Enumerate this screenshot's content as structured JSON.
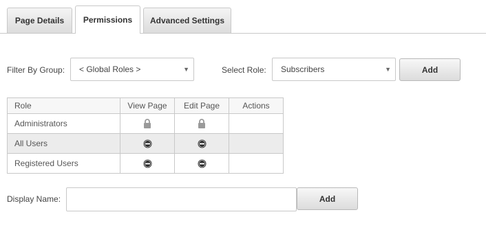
{
  "tabs": [
    {
      "label": "Page Details"
    },
    {
      "label": "Permissions"
    },
    {
      "label": "Advanced Settings"
    }
  ],
  "filter": {
    "group_label": "Filter By Group:",
    "group_value": "< Global Roles >",
    "role_label": "Select Role:",
    "role_value": "Subscribers",
    "add_label": "Add"
  },
  "table": {
    "headers": [
      "Role",
      "View Page",
      "Edit Page",
      "Actions"
    ],
    "rows": [
      {
        "role": "Administrators",
        "view": "lock-icon",
        "edit": "lock-icon"
      },
      {
        "role": "All Users",
        "view": "deny-icon",
        "edit": "deny-icon"
      },
      {
        "role": "Registered Users",
        "view": "deny-icon",
        "edit": "deny-icon"
      }
    ]
  },
  "display_name": {
    "label": "Display Name:",
    "value": "",
    "add_label": "Add"
  }
}
